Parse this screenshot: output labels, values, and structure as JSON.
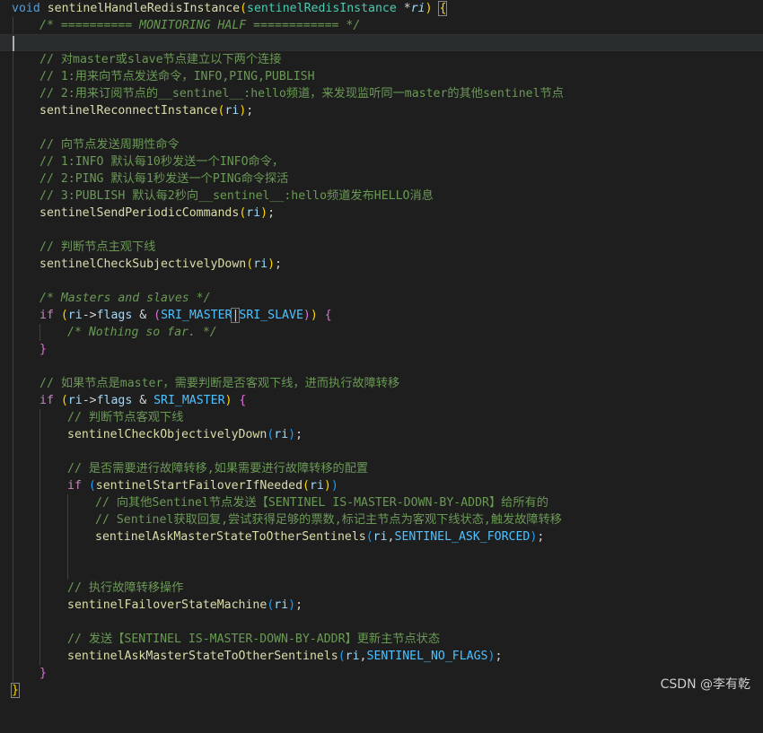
{
  "code": {
    "fn_keyword": "void",
    "fn_name": "sentinelHandleRedisInstance",
    "param_type": "sentinelRedisInstance",
    "param_ptr": "*",
    "param_name": "ri",
    "monitoring_comment": "/* ========== MONITORING HALF ============ */",
    "c1": "// 对master或slave节点建立以下两个连接",
    "c2": "// 1:用来向节点发送命令，INFO,PING,PUBLISH",
    "c3": "// 2:用来订阅节点的__sentinel__:hello频道，来发现监听同一master的其他sentinel节点",
    "call_reconnect": "sentinelReconnectInstance",
    "c4": "// 向节点发送周期性命令",
    "c5": "// 1:INFO 默认每10秒发送一个INFO命令，",
    "c6": "// 2:PING 默认每1秒发送一个PING命令探活",
    "c7": "// 3:PUBLISH 默认每2秒向__sentinel__:hello频道发布HELLO消息",
    "call_periodic": "sentinelSendPeriodicCommands",
    "c8": "// 判断节点主观下线",
    "call_sdown": "sentinelCheckSubjectivelyDown",
    "c9": "/* Masters and slaves */",
    "kw_if": "if",
    "flags": "flags",
    "const_master": "SRI_MASTER",
    "const_slave": "SRI_SLAVE",
    "c10": "/* Nothing so far. */",
    "c11": "// 如果节点是master，需要判断是否客观下线，进而执行故障转移",
    "c12": "// 判断节点客观下线",
    "call_odown": "sentinelCheckObjectivelyDown",
    "c13": "// 是否需要进行故障转移,如果需要进行故障转移的配置",
    "call_start_failover": "sentinelStartFailoverIfNeeded",
    "c14": "// 向其他Sentinel节点发送【SENTINEL IS-MASTER-DOWN-BY-ADDR】给所有的",
    "c15": "// Sentinel获取回复,尝试获得足够的票数,标记主节点为客观下线状态,触发故障转移",
    "call_ask": "sentinelAskMasterStateToOtherSentinels",
    "const_ask_forced": "SENTINEL_ASK_FORCED",
    "c16": "// 执行故障转移操作",
    "call_state_machine": "sentinelFailoverStateMachine",
    "c17": "// 发送【SENTINEL IS-MASTER-DOWN-BY-ADDR】更新主节点状态",
    "const_no_flags": "SENTINEL_NO_FLAGS"
  },
  "watermark": "CSDN @李有乾",
  "colors": {
    "background": "#1e1e1e",
    "keyword": "#569cd6",
    "control": "#c586c0",
    "function": "#dcdcaa",
    "type": "#4ec9b0",
    "variable": "#9cdcfe",
    "constant": "#4fc1ff",
    "comment": "#6a9955"
  }
}
